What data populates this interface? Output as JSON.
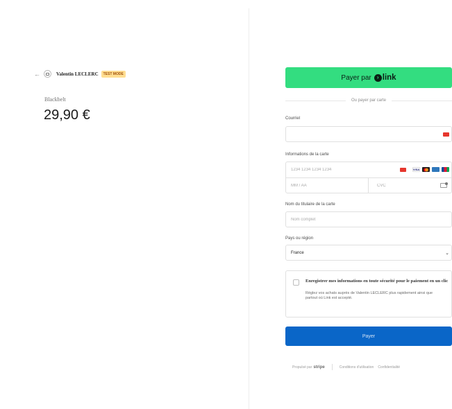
{
  "merchant": {
    "back_icon": "arrow-left-icon",
    "name": "Valentin LECLERC",
    "badge": "TEST MODE"
  },
  "product": {
    "name": "Blackbelt",
    "price": "29,90 €"
  },
  "checkout": {
    "link_button": {
      "prefix": "Payer par",
      "brand": "link",
      "color": "#33dd80"
    },
    "or_text": "Ou payer par carte",
    "email": {
      "label": "Courriel",
      "value": ""
    },
    "card": {
      "label": "Informations de la carte",
      "number_placeholder": "1234 1234 1234 1234",
      "expiry_placeholder": "MM / AA",
      "cvc_placeholder": "CVC",
      "brands": [
        "visa",
        "mastercard",
        "amex",
        "jcb"
      ]
    },
    "cardholder": {
      "label": "Nom du titulaire de la carte",
      "placeholder": "Nom complet"
    },
    "country": {
      "label": "Pays ou région",
      "value": "France"
    },
    "save": {
      "title": "Enregistrer mes informations en toute sécurité pour le paiement en un clic",
      "description": "Réglez vos achats auprès de Valentin LECLERC plus rapidement ainsi que partout où Link est accepté."
    },
    "pay_button": {
      "label": "Payer",
      "color": "#0a66c8"
    }
  },
  "footer": {
    "powered_by": "Propulsé par",
    "stripe": "stripe",
    "terms": "Conditions d'utilisation",
    "privacy": "Confidentialité"
  }
}
